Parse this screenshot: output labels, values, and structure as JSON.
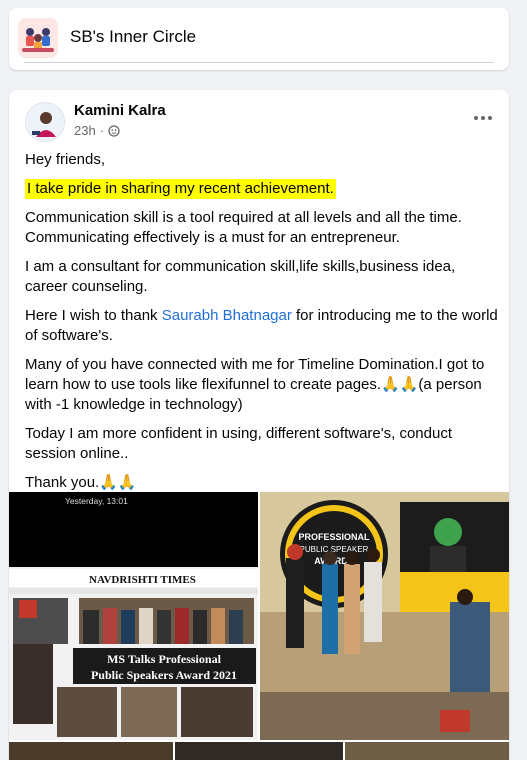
{
  "group": {
    "name": "SB's Inner Circle"
  },
  "post": {
    "author": "Kamini Kalra",
    "time": "23h",
    "dot": " · ",
    "paragraphs": {
      "greeting": "Hey friends,",
      "highlight": "I take pride in sharing my recent achievement.",
      "p1": "Communication skill is a tool required at all levels and all the time. Communicating effectively is a must for an entrepreneur.",
      "p2": "I am a consultant for communication skill,life skills,business idea, career counseling.",
      "p3_before": "Here I wish to thank ",
      "p3_mention": "Saurabh Bhatnagar",
      "p3_after": " for introducing me to the world of software's.",
      "p4": "Many of you have connected with me for Timeline Domination.I got to learn how to use tools like flexifunnel to create pages.🙏🙏(a person with -1 knowledge in technology)",
      "p5": "Today I am more confident in using, different software's, conduct session online..",
      "p6": "Thank you.🙏🙏"
    },
    "photos": {
      "left": {
        "timestamp": "Yesterday, 13:01",
        "paper_name": "NAVDRISHTI TIMES",
        "headline_1": "MS Talks Professional",
        "headline_2": "Public Speakers Award 2021"
      },
      "right": {
        "banner_1": "PROFESSIONAL",
        "banner_2": "PUBLIC SPEAKER",
        "banner_3": "AWARDS"
      }
    }
  },
  "colors": {
    "highlight": "#ffff00",
    "mention": "#216fdb",
    "meta": "#65676b"
  }
}
